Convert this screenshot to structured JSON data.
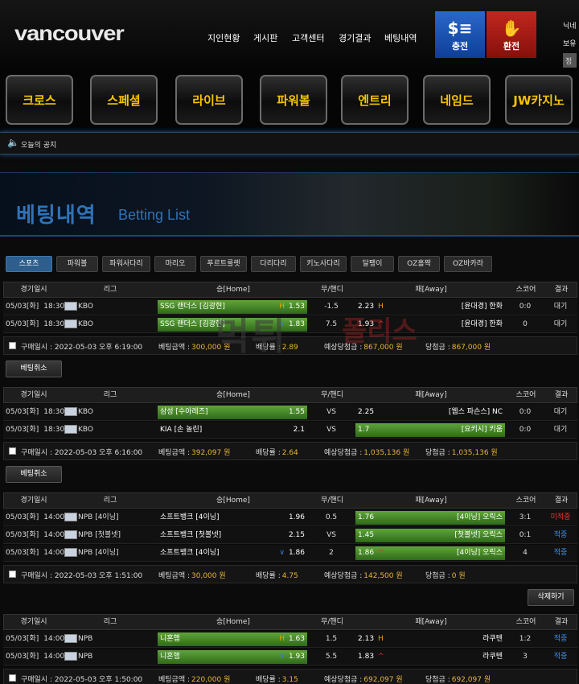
{
  "header": {
    "logo": "vancouver",
    "nav": [
      "지인현황",
      "게시판",
      "고객센터",
      "경기결과",
      "베팅내역"
    ],
    "deposit": "충전",
    "withdraw": "환전",
    "user_line1": "닉네",
    "user_line2": "보유",
    "user_line3": "정"
  },
  "games": [
    "크로스",
    "스페셜",
    "라이브",
    "파워볼",
    "엔트리",
    "네임드",
    "JW카지노"
  ],
  "notice": "오늘의 공지",
  "banner": {
    "kr": "베팅내역",
    "en": "Betting List"
  },
  "watermark": {
    "a": "먹튀",
    "b": "폴리스"
  },
  "tabs": [
    "스포츠",
    "파워볼",
    "파워사다리",
    "마리오",
    "푸르트룰렛",
    "다리다리",
    "키노사다리",
    "달팽이",
    "OZ홀짝",
    "OZ바카라"
  ],
  "columns": [
    "경기일시",
    "리그",
    "승[Home]",
    "무/핸디",
    "패[Away]",
    "스코어",
    "결과"
  ],
  "slips": [
    {
      "rows": [
        {
          "date": "05/03[화]",
          "time": "18:30",
          "league": "KBO",
          "home": "SSG 랜더스 [김광현]",
          "home_odds": "1.53",
          "home_mark": "H",
          "home_sel": true,
          "handi": "-1.5",
          "away": "[윤대경] 한화",
          "away_odds": "2.23",
          "away_mark": "H",
          "away_sel": false,
          "score": "0:0",
          "result": "대기",
          "result_color": "plain"
        },
        {
          "date": "05/03[화]",
          "time": "18:30",
          "league": "KBO",
          "home": "SSG 랜더스 [김광현]",
          "home_odds": "1.83",
          "home_mark": "∨",
          "home_sel": true,
          "handi": "7.5",
          "away": "[윤대경] 한화",
          "away_odds": "1.93",
          "away_mark": "^",
          "away_sel": false,
          "score": "0",
          "result": "대기",
          "result_color": "plain"
        }
      ],
      "purchase": "구매일시 : 2022-05-03 오후 6:19:00",
      "amount_label": "베팅금액 :",
      "amount": "300,000 원",
      "odds_label": "배당률 :",
      "odds": "2.89",
      "expected_label": "예상당첨금 :",
      "expected": "867,000 원",
      "win_label": "당첨금 :",
      "win": "867,000 원",
      "button": "베팅취소"
    },
    {
      "rows": [
        {
          "date": "05/03[화]",
          "time": "18:30",
          "league": "KBO",
          "home": "삼성 [수아레즈]",
          "home_odds": "1.55",
          "home_mark": "",
          "home_sel": true,
          "handi": "VS",
          "away": "[웹스 파슨스] NC",
          "away_odds": "2.25",
          "away_mark": "",
          "away_sel": false,
          "score": "0:0",
          "result": "대기",
          "result_color": "plain"
        },
        {
          "date": "05/03[화]",
          "time": "18:30",
          "league": "KBO",
          "home": "KIA [손 놀린]",
          "home_odds": "2.1",
          "home_mark": "",
          "home_sel": false,
          "handi": "VS",
          "away": "[요키시] 키움",
          "away_odds": "1.7",
          "away_mark": "",
          "away_sel": true,
          "score": "0:0",
          "result": "대기",
          "result_color": "plain"
        }
      ],
      "purchase": "구매일시 : 2022-05-03 오후 6:16:00",
      "amount_label": "베팅금액 :",
      "amount": "392,097 원",
      "odds_label": "배당률 :",
      "odds": "2.64",
      "expected_label": "예상당첨금 :",
      "expected": "1,035,136 원",
      "win_label": "당첨금 :",
      "win": "1,035,136 원",
      "button": "베팅취소"
    },
    {
      "rows": [
        {
          "date": "05/03[화]",
          "time": "14:00",
          "league": "NPB [4이닝]",
          "home": "소프트뱅크 [4이닝]",
          "home_odds": "1.96",
          "home_mark": "",
          "home_sel": false,
          "handi": "0.5",
          "away": "[4이닝] 오릭스",
          "away_odds": "1.76",
          "away_mark": "",
          "away_sel": true,
          "score": "3:1",
          "result": "미적중",
          "result_color": "red"
        },
        {
          "date": "05/03[화]",
          "time": "14:00",
          "league": "NPB [첫볼넷]",
          "home": "소프트뱅크 [첫볼넷]",
          "home_odds": "2.15",
          "home_mark": "",
          "home_sel": false,
          "handi": "VS",
          "away": "[첫볼넷] 오릭스",
          "away_odds": "1.45",
          "away_mark": "",
          "away_sel": true,
          "score": "0:1",
          "result": "적중",
          "result_color": "blue"
        },
        {
          "date": "05/03[화]",
          "time": "14:00",
          "league": "NPB [4이닝]",
          "home": "소프트뱅크 [4이닝]",
          "home_odds": "1.86",
          "home_mark": "∨",
          "home_sel": false,
          "handi": "2",
          "away": "[4이닝] 오릭스",
          "away_odds": "1.86",
          "away_mark": "^",
          "away_sel": true,
          "score": "4",
          "result": "적중",
          "result_color": "blue"
        }
      ],
      "purchase": "구매일시 : 2022-05-03 오후 1:51:00",
      "amount_label": "베팅금액 :",
      "amount": "30,000 원",
      "odds_label": "배당률 :",
      "odds": "4.75",
      "expected_label": "예상당첨금 :",
      "expected": "142,500 원",
      "win_label": "당첨금 :",
      "win": "0 원",
      "button": "삭제하기"
    },
    {
      "rows": [
        {
          "date": "05/03[화]",
          "time": "14:00",
          "league": "NPB",
          "home": "니혼햄",
          "home_odds": "1.63",
          "home_mark": "H",
          "home_sel": true,
          "handi": "1.5",
          "away": "라쿠텐",
          "away_odds": "2.13",
          "away_mark": "H",
          "away_sel": false,
          "score": "1:2",
          "result": "적중",
          "result_color": "blue"
        },
        {
          "date": "05/03[화]",
          "time": "14:00",
          "league": "NPB",
          "home": "니혼햄",
          "home_odds": "1.93",
          "home_mark": "∨",
          "home_sel": true,
          "handi": "5.5",
          "away": "라쿠텐",
          "away_odds": "1.83",
          "away_mark": "^",
          "away_sel": false,
          "score": "3",
          "result": "적중",
          "result_color": "blue"
        }
      ],
      "purchase": "구매일시 : 2022-05-03 오후 1:50:00",
      "amount_label": "베팅금액 :",
      "amount": "220,000 원",
      "odds_label": "배당률 :",
      "odds": "3.15",
      "expected_label": "예상당첨금 :",
      "expected": "692,097 원",
      "win_label": "당첨금 :",
      "win": "692,097 원",
      "button": ""
    }
  ],
  "colors": {
    "accent_blue": "#2d5e8c",
    "selected_green": "#4f9a2e",
    "game_text": "#f5c400",
    "deposit": "#1f57b5",
    "withdraw": "#a91c15"
  }
}
